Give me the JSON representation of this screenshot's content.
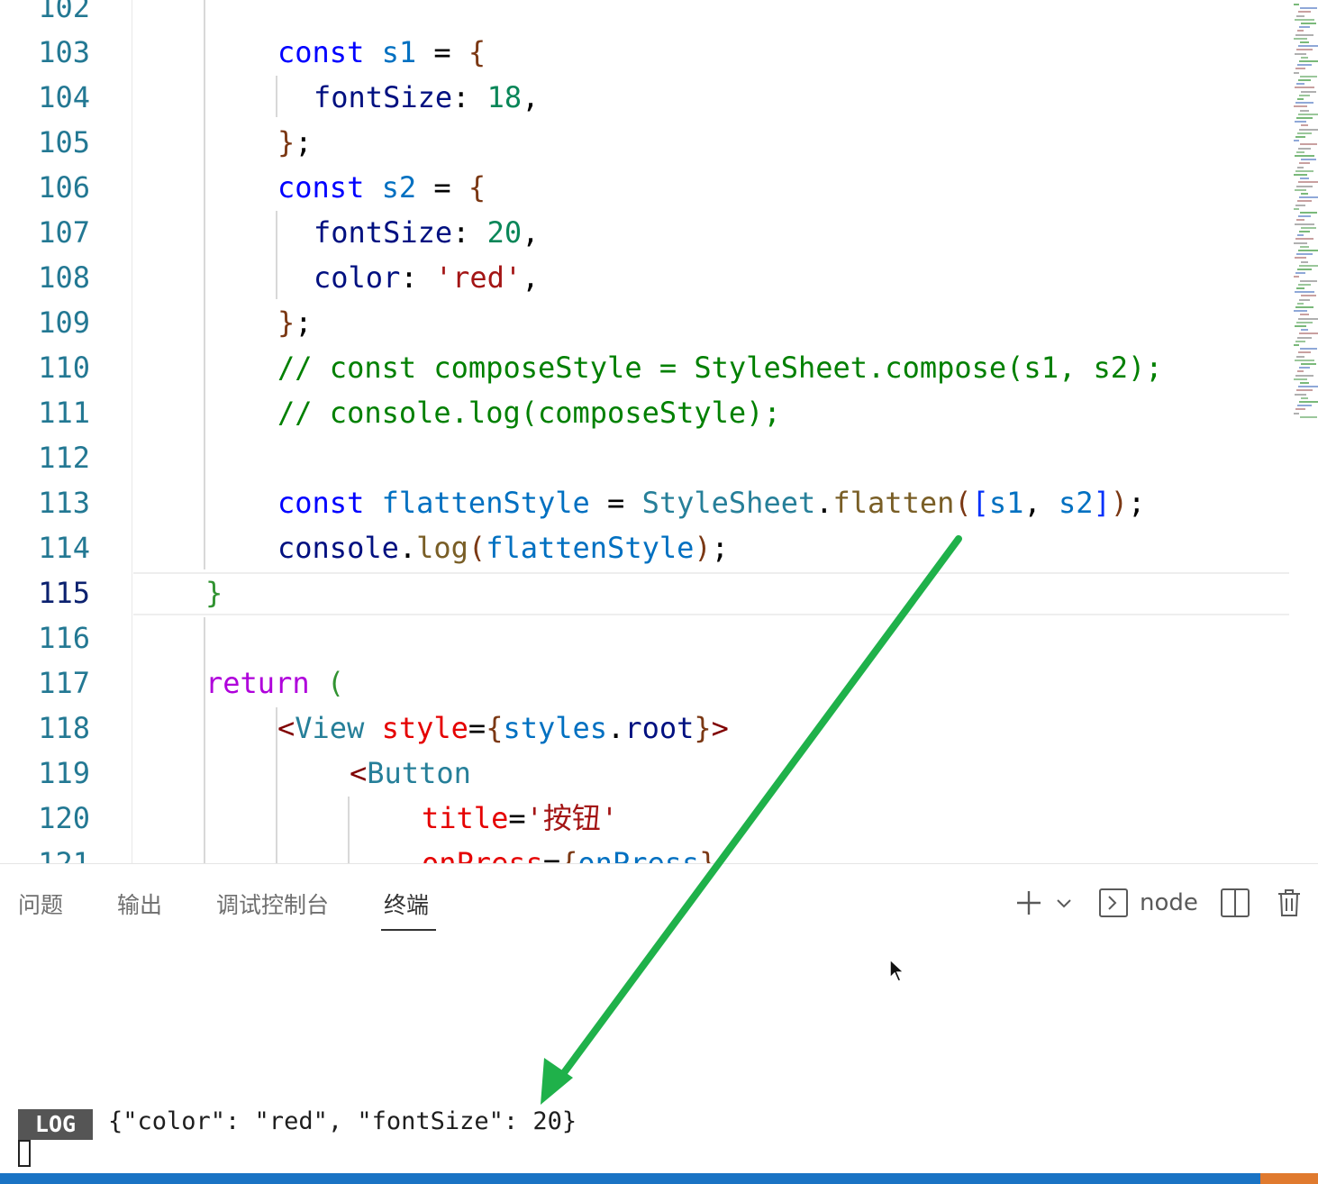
{
  "editor": {
    "line_numbers": [
      "102",
      "103",
      "104",
      "105",
      "106",
      "107",
      "108",
      "109",
      "110",
      "111",
      "112",
      "113",
      "114",
      "115",
      "116",
      "117",
      "118",
      "119",
      "120",
      "121"
    ],
    "active_line": "115",
    "lines": [
      [],
      [
        {
          "t": "const ",
          "c": "kw"
        },
        {
          "t": "s1",
          "c": "var"
        },
        {
          "t": " = ",
          "c": "txt"
        },
        {
          "t": "{",
          "c": "brk3"
        }
      ],
      [
        {
          "t": "fontSize",
          "c": "prop"
        },
        {
          "t": ": ",
          "c": "txt"
        },
        {
          "t": "18",
          "c": "num"
        },
        {
          "t": ",",
          "c": "txt"
        }
      ],
      [
        {
          "t": "}",
          "c": "brk3"
        },
        {
          "t": ";",
          "c": "txt"
        }
      ],
      [
        {
          "t": "const ",
          "c": "kw"
        },
        {
          "t": "s2",
          "c": "var"
        },
        {
          "t": " = ",
          "c": "txt"
        },
        {
          "t": "{",
          "c": "brk3"
        }
      ],
      [
        {
          "t": "fontSize",
          "c": "prop"
        },
        {
          "t": ": ",
          "c": "txt"
        },
        {
          "t": "20",
          "c": "num"
        },
        {
          "t": ",",
          "c": "txt"
        }
      ],
      [
        {
          "t": "color",
          "c": "prop"
        },
        {
          "t": ": ",
          "c": "txt"
        },
        {
          "t": "'red'",
          "c": "str"
        },
        {
          "t": ",",
          "c": "txt"
        }
      ],
      [
        {
          "t": "}",
          "c": "brk3"
        },
        {
          "t": ";",
          "c": "txt"
        }
      ],
      [
        {
          "t": "// const composeStyle = StyleSheet.compose(s1, s2);",
          "c": "cmt"
        }
      ],
      [
        {
          "t": "// console.log(composeStyle);",
          "c": "cmt"
        }
      ],
      [],
      [
        {
          "t": "const ",
          "c": "kw"
        },
        {
          "t": "flattenStyle",
          "c": "var"
        },
        {
          "t": " = ",
          "c": "txt"
        },
        {
          "t": "StyleSheet",
          "c": "typ"
        },
        {
          "t": ".",
          "c": "txt"
        },
        {
          "t": "flatten",
          "c": "fn"
        },
        {
          "t": "(",
          "c": "brk3"
        },
        {
          "t": "[",
          "c": "brk1"
        },
        {
          "t": "s1",
          "c": "var"
        },
        {
          "t": ", ",
          "c": "txt"
        },
        {
          "t": "s2",
          "c": "var"
        },
        {
          "t": "]",
          "c": "brk1"
        },
        {
          "t": ")",
          "c": "brk3"
        },
        {
          "t": ";",
          "c": "txt"
        }
      ],
      [
        {
          "t": "console",
          "c": "prop"
        },
        {
          "t": ".",
          "c": "txt"
        },
        {
          "t": "log",
          "c": "fn"
        },
        {
          "t": "(",
          "c": "brk3"
        },
        {
          "t": "flattenStyle",
          "c": "var"
        },
        {
          "t": ")",
          "c": "brk3"
        },
        {
          "t": ";",
          "c": "txt"
        }
      ],
      [
        {
          "t": "}",
          "c": "brk2"
        }
      ],
      [],
      [
        {
          "t": "return ",
          "c": "ctl"
        },
        {
          "t": "(",
          "c": "brk2"
        }
      ],
      [
        {
          "t": "<",
          "c": "tag"
        },
        {
          "t": "View",
          "c": "typ"
        },
        {
          "t": " ",
          "c": "txt"
        },
        {
          "t": "style",
          "c": "attr"
        },
        {
          "t": "=",
          "c": "txt"
        },
        {
          "t": "{",
          "c": "brk3"
        },
        {
          "t": "styles",
          "c": "var"
        },
        {
          "t": ".",
          "c": "txt"
        },
        {
          "t": "root",
          "c": "prop"
        },
        {
          "t": "}",
          "c": "brk3"
        },
        {
          "t": ">",
          "c": "tag"
        }
      ],
      [
        {
          "t": "<",
          "c": "tag"
        },
        {
          "t": "Button",
          "c": "typ"
        }
      ],
      [
        {
          "t": "title",
          "c": "attr"
        },
        {
          "t": "=",
          "c": "txt"
        },
        {
          "t": "'按钮'",
          "c": "str"
        }
      ],
      [
        {
          "t": "onPress",
          "c": "attr"
        },
        {
          "t": "=",
          "c": "txt"
        },
        {
          "t": "{",
          "c": "brk3"
        },
        {
          "t": "onPress",
          "c": "var"
        },
        {
          "t": "}",
          "c": "brk3"
        }
      ]
    ]
  },
  "panel": {
    "tabs": [
      "问题",
      "输出",
      "调试控制台",
      "终端"
    ],
    "active_tab": "终端",
    "terminal_name": "node",
    "log_badge": "LOG",
    "log_output": "{\"color\": \"red\", \"fontSize\": 20}"
  },
  "colors": {
    "arrow": "#1fb14a",
    "statusbar": "#1a73c4",
    "line_number": "#237893"
  },
  "icons": [
    "plus-icon",
    "chevron-down-icon",
    "terminal-icon",
    "split-terminal-icon",
    "trash-icon",
    "mouse-pointer-icon"
  ]
}
